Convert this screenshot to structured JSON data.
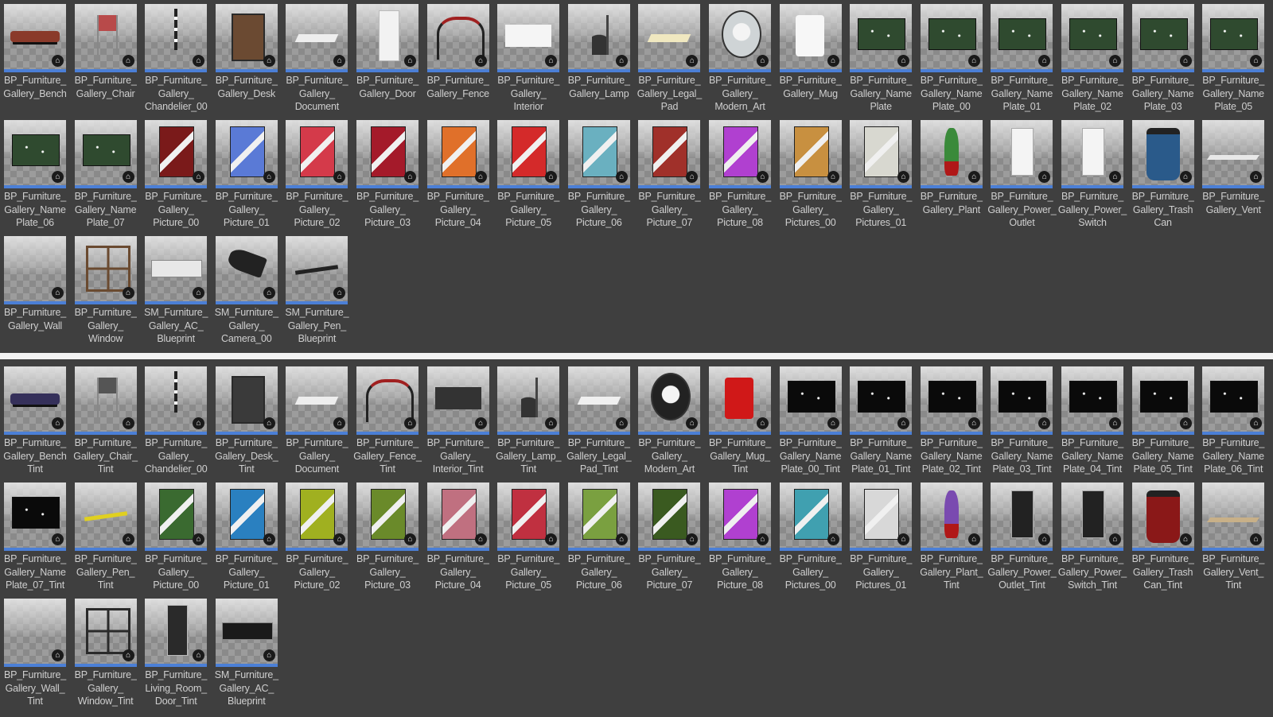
{
  "browser": {
    "top_assets": [
      {
        "label": "BP_Furniture_\nGallery_Bench",
        "icon": "bench",
        "color": "#8a3a2a"
      },
      {
        "label": "BP_Furniture_\nGallery_Chair",
        "icon": "chair",
        "color": "#b84a4a"
      },
      {
        "label": "BP_Furniture_\nGallery_\nChandelier_00",
        "icon": "chandelier",
        "color": "#222222"
      },
      {
        "label": "BP_Furniture_\nGallery_Desk",
        "icon": "desk",
        "color": "#6b4a32"
      },
      {
        "label": "BP_Furniture_\nGallery_\nDocument",
        "icon": "document",
        "color": "#eeeeee"
      },
      {
        "label": "BP_Furniture_\nGallery_Door",
        "icon": "door",
        "color": "#f2f2f2"
      },
      {
        "label": "BP_Furniture_\nGallery_Fence",
        "icon": "fence",
        "color": "#a02020"
      },
      {
        "label": "BP_Furniture_\nGallery_\nInterior",
        "icon": "interior",
        "color": "#f5f5f5"
      },
      {
        "label": "BP_Furniture_\nGallery_Lamp",
        "icon": "lamp",
        "color": "#333333"
      },
      {
        "label": "BP_Furniture_\nGallery_Legal_\nPad",
        "icon": "pad",
        "color": "#f0e8c0"
      },
      {
        "label": "BP_Furniture_\nGallery_\nModern_Art",
        "icon": "modern-art",
        "color": "#cfd4d6"
      },
      {
        "label": "BP_Furniture_\nGallery_Mug",
        "icon": "mug",
        "color": "#f7f7f7"
      },
      {
        "label": "BP_Furniture_\nGallery_Name\nPlate",
        "icon": "nameplate",
        "color": "#2f4a2f"
      },
      {
        "label": "BP_Furniture_\nGallery_Name\nPlate_00",
        "icon": "nameplate",
        "color": "#2f4a2f"
      },
      {
        "label": "BP_Furniture_\nGallery_Name\nPlate_01",
        "icon": "nameplate",
        "color": "#2f4a2f"
      },
      {
        "label": "BP_Furniture_\nGallery_Name\nPlate_02",
        "icon": "nameplate",
        "color": "#2f4a2f"
      },
      {
        "label": "BP_Furniture_\nGallery_Name\nPlate_03",
        "icon": "nameplate",
        "color": "#2f4a2f"
      },
      {
        "label": "BP_Furniture_\nGallery_Name\nPlate_05",
        "icon": "nameplate",
        "color": "#2f4a2f"
      },
      {
        "label": "BP_Furniture_\nGallery_Name\nPlate_06",
        "icon": "nameplate",
        "color": "#2f4a2f"
      },
      {
        "label": "BP_Furniture_\nGallery_Name\nPlate_07",
        "icon": "nameplate",
        "color": "#2f4a2f"
      },
      {
        "label": "BP_Furniture_\nGallery_\nPicture_00",
        "icon": "picture",
        "color": "#7a1a1a"
      },
      {
        "label": "BP_Furniture_\nGallery_\nPicture_01",
        "icon": "picture",
        "color": "#5a7ad6"
      },
      {
        "label": "BP_Furniture_\nGallery_\nPicture_02",
        "icon": "picture",
        "color": "#d43a4a"
      },
      {
        "label": "BP_Furniture_\nGallery_\nPicture_03",
        "icon": "picture",
        "color": "#a41a2a"
      },
      {
        "label": "BP_Furniture_\nGallery_\nPicture_04",
        "icon": "picture",
        "color": "#e0702a"
      },
      {
        "label": "BP_Furniture_\nGallery_\nPicture_05",
        "icon": "picture",
        "color": "#d42a2a"
      },
      {
        "label": "BP_Furniture_\nGallery_\nPicture_06",
        "icon": "picture",
        "color": "#6ab0c0"
      },
      {
        "label": "BP_Furniture_\nGallery_\nPicture_07",
        "icon": "picture",
        "color": "#a0302a"
      },
      {
        "label": "BP_Furniture_\nGallery_\nPicture_08",
        "icon": "picture",
        "color": "#b040d0"
      },
      {
        "label": "BP_Furniture_\nGallery_\nPictures_00",
        "icon": "picture",
        "color": "#c89040"
      },
      {
        "label": "BP_Furniture_\nGallery_\nPictures_01",
        "icon": "picture",
        "color": "#d8d8d0"
      },
      {
        "label": "BP_Furniture_\nGallery_Plant",
        "icon": "plant",
        "color": "#3a8a3a"
      },
      {
        "label": "BP_Furniture_\nGallery_Power_\nOutlet",
        "icon": "outlet",
        "color": "#f4f4f4"
      },
      {
        "label": "BP_Furniture_\nGallery_Power_\nSwitch",
        "icon": "outlet",
        "color": "#f4f4f4"
      },
      {
        "label": "BP_Furniture_\nGallery_Trash\nCan",
        "icon": "trash",
        "color": "#2a5a8a"
      },
      {
        "label": "BP_Furniture_\nGallery_Vent",
        "icon": "vent",
        "color": "#e8e8e8"
      },
      {
        "label": "BP_Furniture_\nGallery_Wall",
        "icon": "wall",
        "color": "#bbbbbb"
      },
      {
        "label": "BP_Furniture_\nGallery_\nWindow",
        "icon": "window",
        "color": "#6a4a30"
      },
      {
        "label": "SM_Furniture_\nGallery_AC_\nBlueprint",
        "icon": "ac",
        "color": "#e8e8e8"
      },
      {
        "label": "SM_Furniture_\nGallery_\nCamera_00",
        "icon": "camera",
        "color": "#222222"
      },
      {
        "label": "SM_Furniture_\nGallery_Pen_\nBlueprint",
        "icon": "pen",
        "color": "#222222"
      }
    ],
    "bottom_assets": [
      {
        "label": "BP_Furniture_\nGallery_Bench\nTint",
        "icon": "bench",
        "color": "#35305a"
      },
      {
        "label": "BP_Furniture_\nGallery_Chair_\nTint",
        "icon": "chair",
        "color": "#555555"
      },
      {
        "label": "BP_Furniture_\nGallery_\nChandelier_00",
        "icon": "chandelier",
        "color": "#222222"
      },
      {
        "label": "BP_Furniture_\nGallery_Desk_\nTint",
        "icon": "desk",
        "color": "#3a3a3a"
      },
      {
        "label": "BP_Furniture_\nGallery_\nDocument",
        "icon": "document",
        "color": "#eeeeee"
      },
      {
        "label": "BP_Furniture_\nGallery_Fence_\nTint",
        "icon": "fence",
        "color": "#a02020"
      },
      {
        "label": "BP_Furniture_\nGallery_\nInterior_Tint",
        "icon": "interior",
        "color": "#333333"
      },
      {
        "label": "BP_Furniture_\nGallery_Lamp_\nTint",
        "icon": "lamp",
        "color": "#333333"
      },
      {
        "label": "BP_Furniture_\nGallery_Legal_\nPad_Tint",
        "icon": "pad",
        "color": "#f0f0f0"
      },
      {
        "label": "BP_Furniture_\nGallery_\nModern_Art",
        "icon": "modern-art",
        "color": "#222222"
      },
      {
        "label": "BP_Furniture_\nGallery_Mug_\nTint",
        "icon": "mug",
        "color": "#d01818"
      },
      {
        "label": "BP_Furniture_\nGallery_Name\nPlate_00_Tint",
        "icon": "nameplate",
        "color": "#0a0a0a"
      },
      {
        "label": "BP_Furniture_\nGallery_Name\nPlate_01_Tint",
        "icon": "nameplate",
        "color": "#0a0a0a"
      },
      {
        "label": "BP_Furniture_\nGallery_Name\nPlate_02_Tint",
        "icon": "nameplate",
        "color": "#0a0a0a"
      },
      {
        "label": "BP_Furniture_\nGallery_Name\nPlate_03_Tint",
        "icon": "nameplate",
        "color": "#0a0a0a"
      },
      {
        "label": "BP_Furniture_\nGallery_Name\nPlate_04_Tint",
        "icon": "nameplate",
        "color": "#0a0a0a"
      },
      {
        "label": "BP_Furniture_\nGallery_Name\nPlate_05_Tint",
        "icon": "nameplate",
        "color": "#0a0a0a"
      },
      {
        "label": "BP_Furniture_\nGallery_Name\nPlate_06_Tint",
        "icon": "nameplate",
        "color": "#0a0a0a"
      },
      {
        "label": "BP_Furniture_\nGallery_Name\nPlate_07_Tint",
        "icon": "nameplate",
        "color": "#0a0a0a"
      },
      {
        "label": "BP_Furniture_\nGallery_Pen_\nTint",
        "icon": "pen",
        "color": "#e0d020"
      },
      {
        "label": "BP_Furniture_\nGallery_\nPicture_00",
        "icon": "picture",
        "color": "#3a6a30"
      },
      {
        "label": "BP_Furniture_\nGallery_\nPicture_01",
        "icon": "picture",
        "color": "#2a80c0"
      },
      {
        "label": "BP_Furniture_\nGallery_\nPicture_02",
        "icon": "picture",
        "color": "#a0b020"
      },
      {
        "label": "BP_Furniture_\nGallery_\nPicture_03",
        "icon": "picture",
        "color": "#6a8a2a"
      },
      {
        "label": "BP_Furniture_\nGallery_\nPicture_04",
        "icon": "picture",
        "color": "#c07080"
      },
      {
        "label": "BP_Furniture_\nGallery_\nPicture_05",
        "icon": "picture",
        "color": "#c03040"
      },
      {
        "label": "BP_Furniture_\nGallery_\nPicture_06",
        "icon": "picture",
        "color": "#7aa040"
      },
      {
        "label": "BP_Furniture_\nGallery_\nPicture_07",
        "icon": "picture",
        "color": "#3a5a20"
      },
      {
        "label": "BP_Furniture_\nGallery_\nPicture_08",
        "icon": "picture",
        "color": "#b040d0"
      },
      {
        "label": "BP_Furniture_\nGallery_\nPictures_00",
        "icon": "picture",
        "color": "#40a0b0"
      },
      {
        "label": "BP_Furniture_\nGallery_\nPictures_01",
        "icon": "picture",
        "color": "#d8d8d8"
      },
      {
        "label": "BP_Furniture_\nGallery_Plant_\nTint",
        "icon": "plant",
        "color": "#7a4ab0"
      },
      {
        "label": "BP_Furniture_\nGallery_Power_\nOutlet_Tint",
        "icon": "outlet",
        "color": "#222222"
      },
      {
        "label": "BP_Furniture_\nGallery_Power_\nSwitch_Tint",
        "icon": "outlet",
        "color": "#222222"
      },
      {
        "label": "BP_Furniture_\nGallery_Trash\nCan_Tint",
        "icon": "trash",
        "color": "#8a1818"
      },
      {
        "label": "BP_Furniture_\nGallery_Vent_\nTint",
        "icon": "vent",
        "color": "#c8b088"
      },
      {
        "label": "BP_Furniture_\nGallery_Wall_\nTint",
        "icon": "wall",
        "color": "#bbbbbb"
      },
      {
        "label": "BP_Furniture_\nGallery_\nWindow_Tint",
        "icon": "window",
        "color": "#2a2a2a"
      },
      {
        "label": "BP_Furniture_\nLiving_Room_\nDoor_Tint",
        "icon": "door",
        "color": "#2a2a2a"
      },
      {
        "label": "SM_Furniture_\nGallery_AC_\nBlueprint",
        "icon": "ac",
        "color": "#1a1a1a"
      }
    ]
  },
  "badge_glyph": "⌂",
  "accent": "#4b7fd6"
}
